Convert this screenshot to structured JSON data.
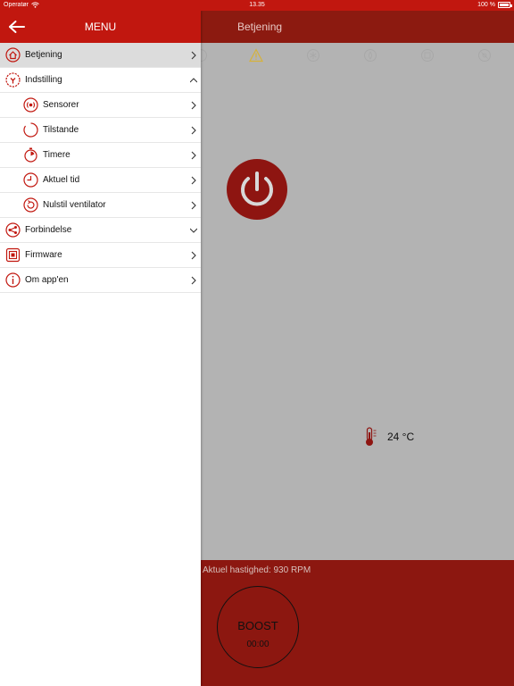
{
  "status_bar": {
    "carrier": "Operatør",
    "time": "13.35",
    "battery": "100 %"
  },
  "menu": {
    "title": "MENU",
    "items": [
      {
        "label": "Betjening",
        "icon": "home-icon",
        "chevron": "right",
        "selected": true,
        "sub": false
      },
      {
        "label": "Indstilling",
        "icon": "settings-icon",
        "chevron": "up",
        "selected": false,
        "sub": false
      },
      {
        "label": "Sensorer",
        "icon": "sensor-icon",
        "chevron": "right",
        "selected": false,
        "sub": true
      },
      {
        "label": "Tilstande",
        "icon": "mode-icon",
        "chevron": "right",
        "selected": false,
        "sub": true
      },
      {
        "label": "Timere",
        "icon": "stopwatch-icon",
        "chevron": "right",
        "selected": false,
        "sub": true
      },
      {
        "label": "Aktuel tid",
        "icon": "clock-icon",
        "chevron": "right",
        "selected": false,
        "sub": true
      },
      {
        "label": "Nulstil ventilator",
        "icon": "reset-icon",
        "chevron": "right",
        "selected": false,
        "sub": true
      },
      {
        "label": "Forbindelse",
        "icon": "share-icon",
        "chevron": "down",
        "selected": false,
        "sub": false
      },
      {
        "label": "Firmware",
        "icon": "chip-icon",
        "chevron": "right",
        "selected": false,
        "sub": false
      },
      {
        "label": "Om app'en",
        "icon": "info-icon",
        "chevron": "right",
        "selected": false,
        "sub": false
      }
    ]
  },
  "main": {
    "title": "Betjening",
    "toolbar_icons": [
      "partial-icon",
      "warning-icon",
      "snowflake-icon",
      "humidity-icon",
      "filter-icon",
      "fan-off-icon"
    ],
    "temperature": "24 °C",
    "speed": "Aktuel hastighed: 930 RPM",
    "boost_label": "BOOST",
    "boost_time": "00:00"
  },
  "colors": {
    "brand_red": "#c1170f",
    "dim_red": "#8c1710",
    "overlay_gray": "#b3b3b3",
    "warning_yellow": "#d6b23a"
  }
}
